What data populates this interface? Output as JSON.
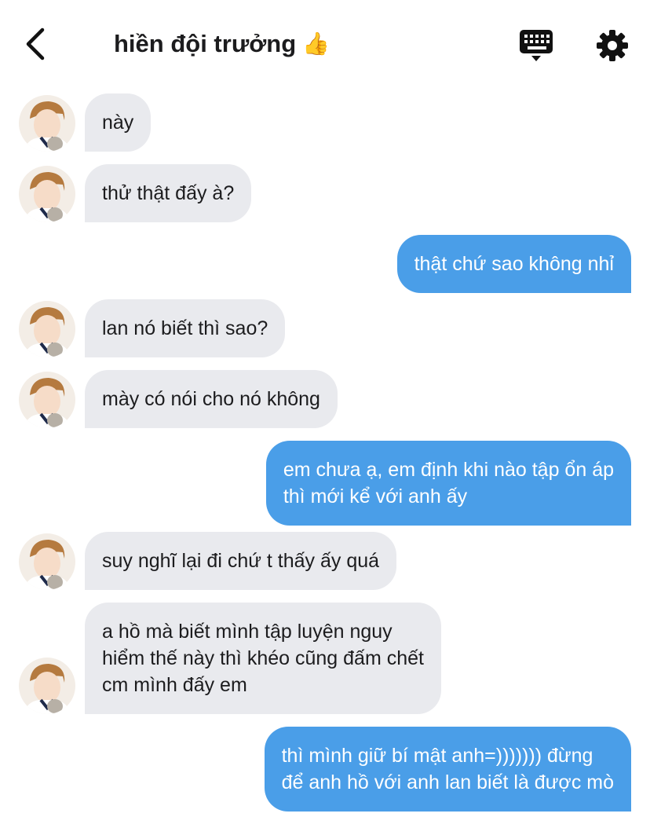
{
  "header": {
    "title": "hiền đội trưởng",
    "title_emoji": "👍",
    "back_icon": "chevron-left-icon",
    "keyboard_icon": "keyboard-icon",
    "settings_icon": "gear-icon"
  },
  "colors": {
    "incoming_bubble": "#e9eaee",
    "outgoing_bubble": "#4a9ee8",
    "outgoing_text": "#ffffff"
  },
  "messages": [
    {
      "dir": "in",
      "lines": [
        "này"
      ]
    },
    {
      "dir": "in",
      "lines": [
        "thử thật đấy à?"
      ]
    },
    {
      "dir": "out",
      "lines": [
        "thật chứ sao không nhỉ"
      ]
    },
    {
      "dir": "in",
      "lines": [
        "lan nó biết thì sao?"
      ]
    },
    {
      "dir": "in",
      "lines": [
        "mày có nói cho nó không"
      ]
    },
    {
      "dir": "out",
      "lines": [
        "em chưa ạ, em định khi nào tập ổn áp",
        "thì mới kể với anh ấy"
      ]
    },
    {
      "dir": "in",
      "lines": [
        "suy nghĩ lại đi chứ t thấy ấy quá"
      ]
    },
    {
      "dir": "in",
      "lines": [
        "a hồ mà biết mình tập luyện nguy",
        "hiểm thế này thì khéo cũng đấm chết",
        "cm mình đấy em"
      ]
    },
    {
      "dir": "out",
      "lines": [
        "thì mình giữ bí mật anh=))))))) đừng",
        "để anh hồ với anh lan biết là được mò"
      ]
    }
  ]
}
